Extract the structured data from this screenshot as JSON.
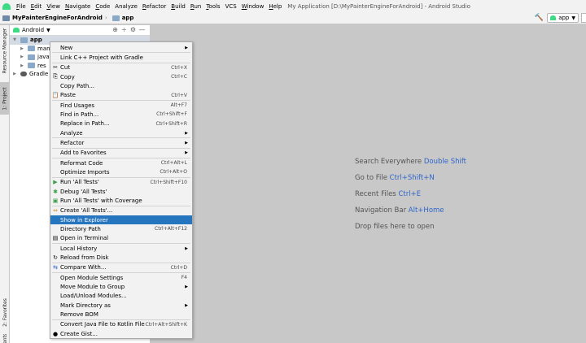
{
  "menubar": {
    "items": [
      {
        "mnemonic": "F",
        "rest": "ile"
      },
      {
        "mnemonic": "E",
        "rest": "dit"
      },
      {
        "mnemonic": "V",
        "rest": "iew"
      },
      {
        "mnemonic": "N",
        "rest": "avigate"
      },
      {
        "mnemonic": "C",
        "rest": "ode"
      },
      {
        "mnemonic": "",
        "rest": "Analyze"
      },
      {
        "mnemonic": "R",
        "rest": "efactor"
      },
      {
        "mnemonic": "B",
        "rest": "uild"
      },
      {
        "mnemonic": "R",
        "rest": "un"
      },
      {
        "mnemonic": "T",
        "rest": "ools"
      },
      {
        "mnemonic": "",
        "rest": "VCS"
      },
      {
        "mnemonic": "W",
        "rest": "indow"
      },
      {
        "mnemonic": "H",
        "rest": "elp"
      }
    ],
    "window_title": "My Application [D:\\MyPainterEngineForAndroid] - Android Studio"
  },
  "navbar": {
    "project": "MyPainterEngineForAndroid",
    "module": "app",
    "run_config": "app"
  },
  "left_strip": {
    "resource_manager": "Resource Manager",
    "project": "1: Project",
    "favorites": "2: Favorites",
    "structure": "ents"
  },
  "project_panel": {
    "view": "Android",
    "tree": [
      {
        "label": "app",
        "arrow": "▼",
        "indent": 0
      },
      {
        "label": "manife",
        "arrow": "▶",
        "indent": 1
      },
      {
        "label": "java",
        "arrow": "▶",
        "indent": 1
      },
      {
        "label": "res",
        "arrow": "▶",
        "indent": 1
      },
      {
        "label": "Gradle Sc",
        "arrow": "▶",
        "indent": 0
      }
    ]
  },
  "context_menu": {
    "items": [
      {
        "label": "New",
        "submenu": true
      },
      {
        "sep": true
      },
      {
        "label": "Link C++ Project with Gradle"
      },
      {
        "sep": true
      },
      {
        "label": "Cut",
        "shortcut": "Ctrl+X",
        "icon": "✂",
        "icon_name": "scissors-icon"
      },
      {
        "label": "Copy",
        "shortcut": "Ctrl+C",
        "icon": "⎘",
        "icon_name": "copy-icon"
      },
      {
        "label": "Copy Path..."
      },
      {
        "label": "Paste",
        "shortcut": "Ctrl+V",
        "icon": "📋",
        "icon_name": "clipboard-icon"
      },
      {
        "sep": true
      },
      {
        "label": "Find Usages",
        "shortcut": "Alt+F7"
      },
      {
        "label": "Find in Path...",
        "shortcut": "Ctrl+Shift+F"
      },
      {
        "label": "Replace in Path...",
        "shortcut": "Ctrl+Shift+R"
      },
      {
        "label": "Analyze",
        "submenu": true
      },
      {
        "sep": true
      },
      {
        "label": "Refactor",
        "submenu": true
      },
      {
        "sep": true
      },
      {
        "label": "Add to Favorites",
        "submenu": true
      },
      {
        "sep": true
      },
      {
        "label": "Reformat Code",
        "shortcut": "Ctrl+Alt+L"
      },
      {
        "label": "Optimize Imports",
        "shortcut": "Ctrl+Alt+O"
      },
      {
        "sep": true
      },
      {
        "label": "Run 'All Tests'",
        "shortcut": "Ctrl+Shift+F10",
        "icon": "▶",
        "icon_name": "run-icon",
        "icon_color": "#3b9e48"
      },
      {
        "label": "Debug 'All Tests'",
        "icon": "✱",
        "icon_name": "debug-icon",
        "icon_color": "#3b9e48"
      },
      {
        "label": "Run 'All Tests' with Coverage",
        "icon": "▣",
        "icon_name": "coverage-icon",
        "icon_color": "#3b9e48"
      },
      {
        "sep": true
      },
      {
        "label": "Create 'All Tests'...",
        "icon": "⇔",
        "icon_name": "create-test-icon",
        "icon_color": "#d98b2b"
      },
      {
        "label": "Show in Explorer",
        "highlight": true
      },
      {
        "label": "Directory Path",
        "shortcut": "Ctrl+Alt+F12"
      },
      {
        "label": "Open in Terminal",
        "icon": "▤",
        "icon_name": "terminal-icon"
      },
      {
        "sep": true
      },
      {
        "label": "Local History",
        "submenu": true
      },
      {
        "label": "Reload from Disk",
        "icon": "↻",
        "icon_name": "reload-icon"
      },
      {
        "sep": true
      },
      {
        "label": "Compare With...",
        "shortcut": "Ctrl+D",
        "icon": "⇆",
        "icon_name": "compare-icon",
        "icon_color": "#2f65ca"
      },
      {
        "sep": true
      },
      {
        "label": "Open Module Settings",
        "shortcut": "F4"
      },
      {
        "label": "Move Module to Group",
        "submenu": true
      },
      {
        "label": "Load/Unload Modules..."
      },
      {
        "label": "Mark Directory as",
        "submenu": true
      },
      {
        "label": "Remove BOM"
      },
      {
        "sep": true
      },
      {
        "label": "Convert Java File to Kotlin File",
        "shortcut": "Ctrl+Alt+Shift+K"
      },
      {
        "label": "Create Gist...",
        "icon": "●",
        "icon_name": "github-icon"
      }
    ]
  },
  "editor_hints": [
    {
      "text": "Search Everywhere",
      "key": "Double Shift"
    },
    {
      "text": "Go to File",
      "key": "Ctrl+Shift+N"
    },
    {
      "text": "Recent Files",
      "key": "Ctrl+E"
    },
    {
      "text": "Navigation Bar",
      "key": "Alt+Home"
    },
    {
      "text": "Drop files here to open",
      "key": ""
    }
  ]
}
